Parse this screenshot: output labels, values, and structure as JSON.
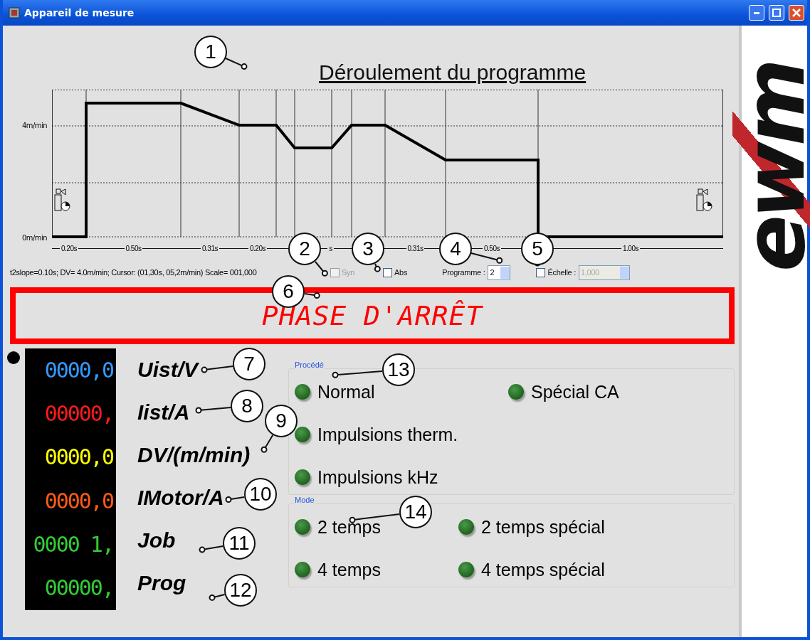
{
  "window": {
    "title": "Appareil de mesure"
  },
  "program": {
    "title": "Déroulement du programme",
    "y_labels": [
      "4m/min",
      "0m/min"
    ],
    "segments": [
      {
        "label": "0.20s"
      },
      {
        "label": "0.50s"
      },
      {
        "label": "0.31s"
      },
      {
        "label": "0.20s"
      },
      {
        "label": "s"
      },
      {
        "label": "0.31s"
      },
      {
        "label": "0.50s"
      },
      {
        "label": "1.00s"
      }
    ]
  },
  "status_text": "t2slope=0.10s; DV= 4.0m/min; Cursor: (01,30s, 05,2m/min) Scale= 001,000",
  "options": [
    {
      "kind": "checkbox",
      "label": "Syn",
      "checked": false,
      "disabled": true
    },
    {
      "kind": "checkbox",
      "label": "Abs",
      "checked": false,
      "disabled": false
    },
    {
      "kind": "spinner",
      "label": "Programme :",
      "value": "2",
      "disabled": false
    },
    {
      "kind": "checkbox",
      "label": "Échelle :",
      "checked": false,
      "disabled": false
    },
    {
      "kind": "spinner",
      "value": "1,000",
      "disabled": true
    }
  ],
  "phase": "PHASE D'ARRÊT",
  "readings": [
    {
      "value": "0000,0",
      "color": "#3399ff",
      "label": "Uist/V"
    },
    {
      "value": "00000,",
      "color": "#ff1a1a",
      "label": "Iist/A"
    },
    {
      "value": "0000,0",
      "color": "#ffff00",
      "label": "DV/(m/min)"
    },
    {
      "value": "0000,0",
      "color": "#ff5a14",
      "label": "IMotor/A"
    },
    {
      "value": "0000 1,",
      "color": "#33cc33",
      "label": "Job"
    },
    {
      "value": "00000,",
      "color": "#33cc33",
      "label": "Prog"
    }
  ],
  "groups": [
    {
      "title": "Procédé",
      "items": [
        {
          "label": "Normal",
          "on": false
        },
        {
          "label": "Spécial CA",
          "on": false
        },
        {
          "label": "Impulsions therm.",
          "on": false
        },
        {
          "label": "Impulsions kHz",
          "on": false
        }
      ]
    },
    {
      "title": "Mode",
      "items": [
        {
          "label": "2 temps",
          "on": false
        },
        {
          "label": "2 temps spécial",
          "on": false
        },
        {
          "label": "4 temps",
          "on": false
        },
        {
          "label": "4 temps spécial",
          "on": false
        }
      ]
    }
  ],
  "logo": "ewm",
  "callouts": [
    "1",
    "2",
    "3",
    "4",
    "5",
    "6",
    "7",
    "8",
    "9",
    "10",
    "11",
    "12",
    "13",
    "14"
  ]
}
